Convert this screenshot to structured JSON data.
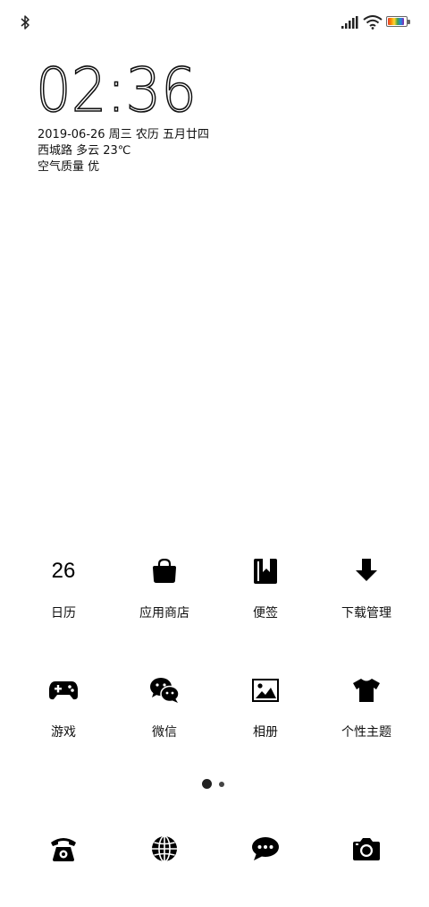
{
  "status_bar": {
    "bluetooth_icon": "bluetooth-icon",
    "signal_icon": "cellular-signal-icon",
    "wifi_icon": "wifi-icon",
    "battery_icon": "battery-icon",
    "battery_fill_percent": 90
  },
  "lockscreen": {
    "time": "02:36",
    "date_line": "2019-06-26 周三 农历 五月廿四",
    "weather_line": "西城路 多云 23℃",
    "air_line": "空气质量 优"
  },
  "apps": [
    {
      "label": "日历",
      "icon": "calendar-icon",
      "icon_text": "26"
    },
    {
      "label": "应用商店",
      "icon": "shopping-bag-icon"
    },
    {
      "label": "便签",
      "icon": "bookmark-notes-icon"
    },
    {
      "label": "下载管理",
      "icon": "download-arrow-icon"
    },
    {
      "label": "游戏",
      "icon": "gamepad-icon"
    },
    {
      "label": "微信",
      "icon": "wechat-icon"
    },
    {
      "label": "相册",
      "icon": "gallery-icon"
    },
    {
      "label": "个性主题",
      "icon": "tshirt-icon"
    }
  ],
  "page_indicator": {
    "count": 2,
    "active": 0
  },
  "dock": [
    {
      "icon": "phone-icon"
    },
    {
      "icon": "browser-globe-icon"
    },
    {
      "icon": "messages-icon"
    },
    {
      "icon": "camera-icon"
    }
  ]
}
